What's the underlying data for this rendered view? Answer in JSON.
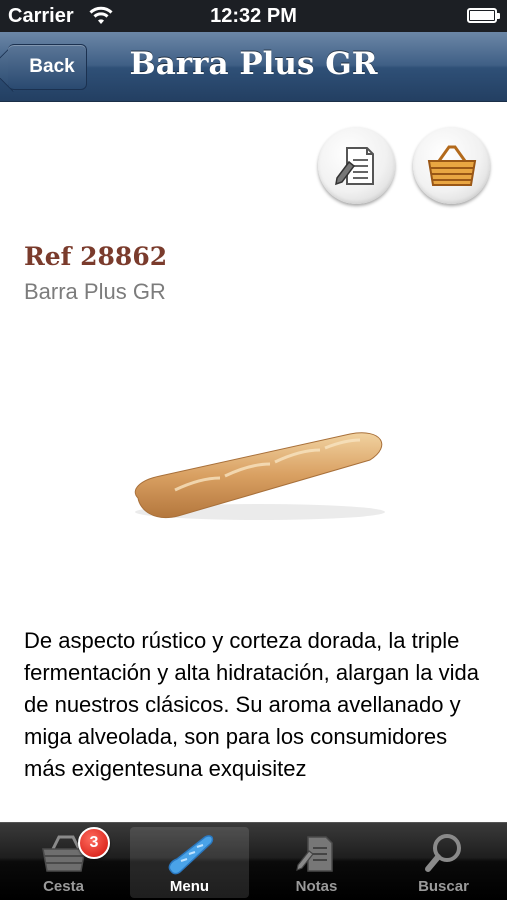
{
  "status_bar": {
    "carrier": "Carrier",
    "time": "12:32 PM",
    "battery_level": 1.0
  },
  "nav_bar": {
    "back_label": "Back",
    "title": "Barra Plus GR"
  },
  "actions": {
    "notes_icon": "notepad-pencil-icon",
    "basket_icon": "basket-icon"
  },
  "product": {
    "ref": "Ref 28862",
    "name": "Barra Plus GR",
    "image": "baguette-image",
    "description": "De aspecto rústico y corteza dorada, la triple fermentación y alta hidratación, alargan la vida de nuestros clásicos. Su aroma avellanado y miga alveolada, son para los consumidores más exigentesuna exquisitez"
  },
  "tab_bar": {
    "tabs": [
      {
        "label": "Cesta",
        "icon": "basket-icon",
        "badge": "3"
      },
      {
        "label": "Menu",
        "icon": "baguette-icon",
        "selected": true
      },
      {
        "label": "Notas",
        "icon": "notes-icon"
      },
      {
        "label": "Buscar",
        "icon": "magnifier-icon"
      }
    ]
  },
  "colors": {
    "nav_bar": "#3f5f85",
    "ref_text": "#7a3b2c",
    "badge": "#d0120a"
  }
}
